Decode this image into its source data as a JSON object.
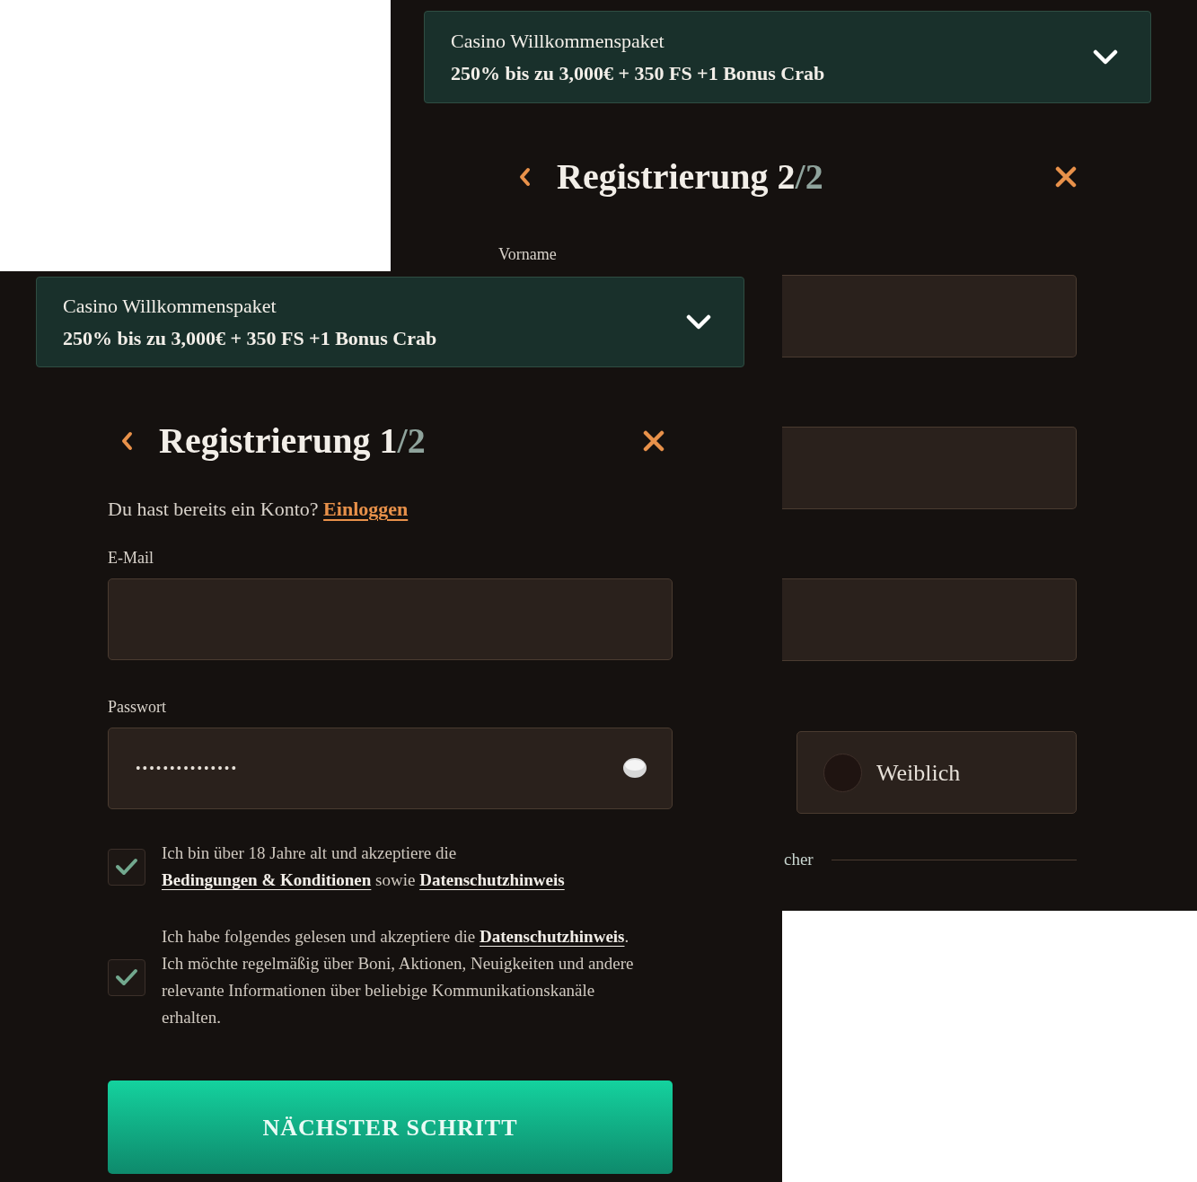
{
  "back_screen": {
    "banner": {
      "title": "Casino Willkommenspaket",
      "offer": "250% bis zu 3,000€ + 350 FS +1 Bonus Crab",
      "expanded": false
    },
    "heading": {
      "title": "Registrierung 2",
      "total": "/2"
    },
    "fields": [
      {
        "kind": "text",
        "label": "Vorname"
      },
      {
        "kind": "text"
      },
      {
        "kind": "text"
      }
    ],
    "gender_options": [
      {
        "label": "Weiblich",
        "selected": false
      }
    ],
    "divider_text": "cher"
  },
  "front_screen": {
    "banner": {
      "title": "Casino Willkommenspaket",
      "offer": "250% bis zu 3,000€ + 350 FS +1 Bonus Crab",
      "expanded": false
    },
    "heading": {
      "title": "Registrierung 1",
      "total": "/2"
    },
    "login_prompt": {
      "text": "Du hast bereits ein Konto?",
      "link": "Einloggen"
    },
    "fields": [
      {
        "kind": "email",
        "label": "E-Mail"
      },
      {
        "kind": "password",
        "label": "Passwort",
        "value": "•••••••••••••••"
      }
    ],
    "consents": [
      {
        "checked": true,
        "parts": [
          {
            "kind": "text",
            "text": "Ich bin über 18 Jahre alt und akzeptiere die"
          },
          {
            "kind": "link",
            "text": "Bedingungen & Konditionen"
          },
          {
            "kind": "text",
            "text": "sowie"
          },
          {
            "kind": "link",
            "text": "Datenschutzhinweis"
          }
        ]
      },
      {
        "checked": true,
        "parts": [
          {
            "kind": "text",
            "text": "Ich habe folgendes gelesen und akzeptiere die"
          },
          {
            "kind": "link",
            "text": "Datenschutzhinweis"
          },
          {
            "kind": "text",
            "text": "."
          },
          {
            "kind": "text",
            "new_line": true,
            "text": "Ich möchte regelmäßig über Boni, Aktionen, Neuigkeiten und andere relevante Informationen über beliebige Kommunikationskanäle erhalten."
          }
        ]
      }
    ],
    "submit_button": "NÄCHSTER SCHRITT"
  }
}
